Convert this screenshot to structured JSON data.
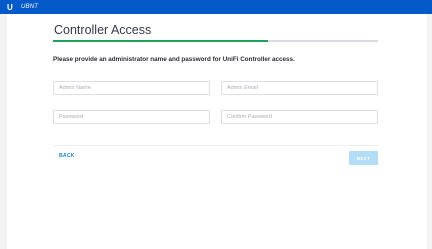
{
  "header": {
    "logo_icon": "ubiquiti-u-logo-icon",
    "brand": "UBNT"
  },
  "page": {
    "title": "Controller Access",
    "progress_fraction": 0.66,
    "progress_color": "#1fa35c",
    "instruction": "Please provide an administrator name and password for UniFi Controller access."
  },
  "form": {
    "admin_name_placeholder": "Admin Name",
    "admin_email_placeholder": "Admin Email",
    "password_placeholder": "Password",
    "confirm_password_placeholder": "Confirm Password"
  },
  "footer": {
    "back_label": "BACK",
    "next_label": "NEXT"
  },
  "colors": {
    "top_bar": "#0559c9",
    "accent": "#1b82d6",
    "next_disabled": "#b3dcf6"
  }
}
